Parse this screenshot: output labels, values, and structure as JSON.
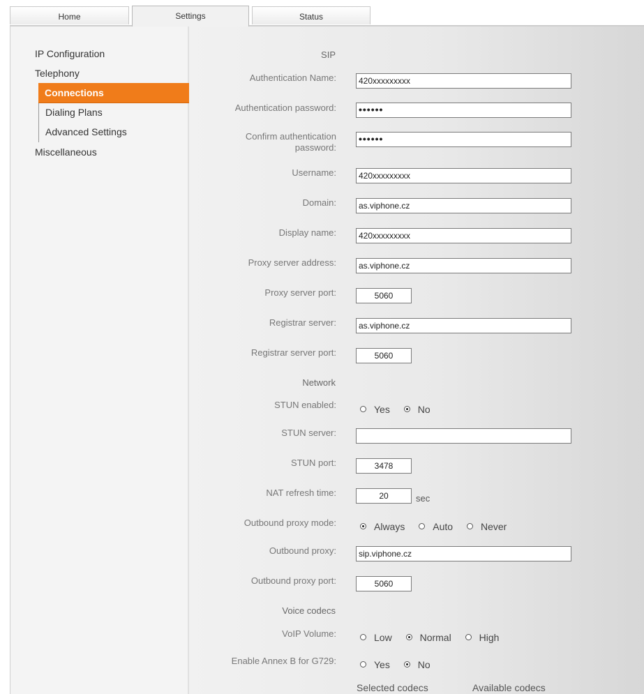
{
  "tabs": [
    "Home",
    "Settings",
    "Status"
  ],
  "sidebar": {
    "items": [
      "IP Configuration",
      "Telephony",
      "Connections",
      "Dialing Plans",
      "Advanced Settings",
      "Miscellaneous"
    ]
  },
  "sections": {
    "sip": "SIP",
    "network": "Network",
    "codecs": "Voice codecs"
  },
  "fields": {
    "auth_name": {
      "label": "Authentication Name:",
      "value": "420xxxxxxxxx"
    },
    "auth_password": {
      "label": "Authentication password:",
      "value": "••••••"
    },
    "confirm_password": {
      "label1": "Confirm authentication",
      "label2": "password:",
      "value": "••••••"
    },
    "username": {
      "label": "Username:",
      "value": "420xxxxxxxxx"
    },
    "domain": {
      "label": "Domain:",
      "value": "as.viphone.cz"
    },
    "display_name": {
      "label": "Display name:",
      "value": "420xxxxxxxxx"
    },
    "proxy_address": {
      "label": "Proxy server address:",
      "value": "as.viphone.cz"
    },
    "proxy_port": {
      "label": "Proxy server port:",
      "value": "5060"
    },
    "registrar_server": {
      "label": "Registrar server:",
      "value": "as.viphone.cz"
    },
    "registrar_port": {
      "label": "Registrar server port:",
      "value": "5060"
    },
    "stun_enabled": {
      "label": "STUN enabled:",
      "yes": "Yes",
      "no": "No",
      "selected": "No"
    },
    "stun_server": {
      "label": "STUN server:",
      "value": ""
    },
    "stun_port": {
      "label": "STUN port:",
      "value": "3478"
    },
    "nat_refresh": {
      "label": "NAT refresh time:",
      "value": "20",
      "unit": "sec"
    },
    "outbound_mode": {
      "label": "Outbound proxy mode:",
      "always": "Always",
      "auto": "Auto",
      "never": "Never",
      "selected": "Always"
    },
    "outbound_proxy": {
      "label": "Outbound proxy:",
      "value": "sip.viphone.cz"
    },
    "outbound_port": {
      "label": "Outbound proxy port:",
      "value": "5060"
    },
    "voip_volume": {
      "label": "VoIP Volume:",
      "low": "Low",
      "normal": "Normal",
      "high": "High",
      "selected": "Normal"
    },
    "annex_b": {
      "label": "Enable Annex B for G729:",
      "yes": "Yes",
      "no": "No",
      "selected": "No"
    }
  },
  "codecs": {
    "selected": "Selected codecs",
    "available": "Available codecs"
  },
  "colors": {
    "accent": "#f07c1a",
    "sidebar_bg": "#f4f4f4"
  }
}
